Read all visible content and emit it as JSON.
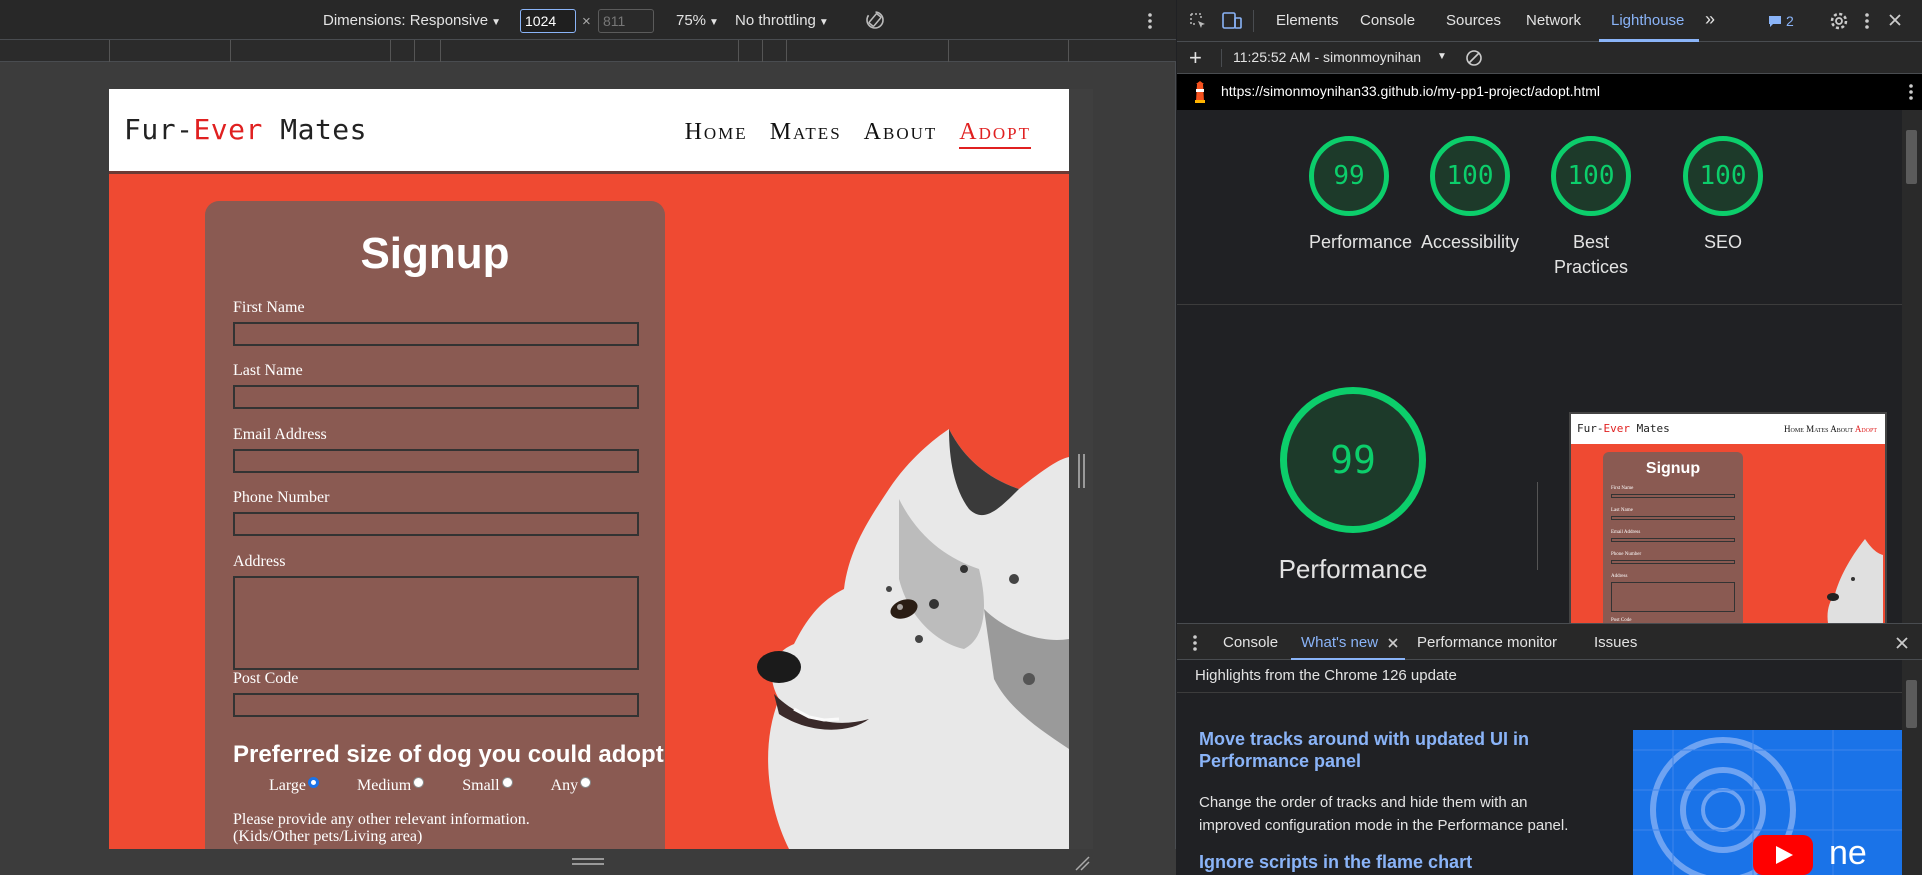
{
  "device_toolbar": {
    "dimensions_label": "Dimensions: Responsive",
    "width_value": "1024",
    "height_placeholder": "811",
    "times": "×",
    "zoom": "75%",
    "throttling": "No throttling"
  },
  "website": {
    "logo_prefix": "Fur-",
    "logo_accent": "Ever",
    "logo_suffix": " Mates",
    "nav": [
      "Home",
      "Mates",
      "About",
      "Adopt"
    ],
    "form": {
      "title": "Signup",
      "fields": [
        "First Name",
        "Last Name",
        "Email Address",
        "Phone Number",
        "Address",
        "Post Code"
      ],
      "preference_title": "Preferred size of dog you could adopt",
      "radios": [
        "Large",
        "Medium",
        "Small",
        "Any"
      ],
      "selected_radio": "Large",
      "other_info_line1": "Please provide any other relevant information.",
      "other_info_line2": "(Kids/Other pets/Living area)"
    }
  },
  "devtools": {
    "tabs": [
      "Elements",
      "Console",
      "Sources",
      "Network",
      "Lighthouse"
    ],
    "active_tab": "Lighthouse",
    "issues_count": "2",
    "report_selector": "11:25:52 AM - simonmoynihan",
    "url": "https://simonmoynihan33.github.io/my-pp1-project/adopt.html",
    "scores": [
      {
        "label": "Performance",
        "value": "99"
      },
      {
        "label": "Accessibility",
        "value": "100"
      },
      {
        "label": "Best Practices",
        "value": "100"
      },
      {
        "label": "SEO",
        "value": "100"
      }
    ],
    "big_score": "99",
    "big_label": "Performance",
    "thumbnail": {
      "logo_prefix": "Fur-",
      "logo_accent": "Ever",
      "logo_suffix": " Mates",
      "nav": "Home Mates About",
      "nav_active": "Adopt",
      "title": "Signup",
      "fields": [
        "First Name",
        "Last Name",
        "Email Address",
        "Phone Number",
        "Address",
        "Post Code"
      ]
    },
    "drawer": {
      "tabs": [
        "Console",
        "What's new",
        "Performance monitor",
        "Issues"
      ],
      "active_tab": "What's new",
      "header": "Highlights from the Chrome 126 update",
      "items": [
        {
          "title": "Move tracks around with updated UI in Performance panel",
          "body": "Change the order of tracks and hide them with an improved configuration mode in the Performance panel."
        },
        {
          "title": "Ignore scripts in the flame chart",
          "body": ""
        }
      ],
      "promo_text": "ne"
    }
  },
  "colors": {
    "site_background": "#ef4a32",
    "form_card": "#8a5a52",
    "score_green": "#0cce6b",
    "devtools_accent": "#8ab4f8"
  }
}
